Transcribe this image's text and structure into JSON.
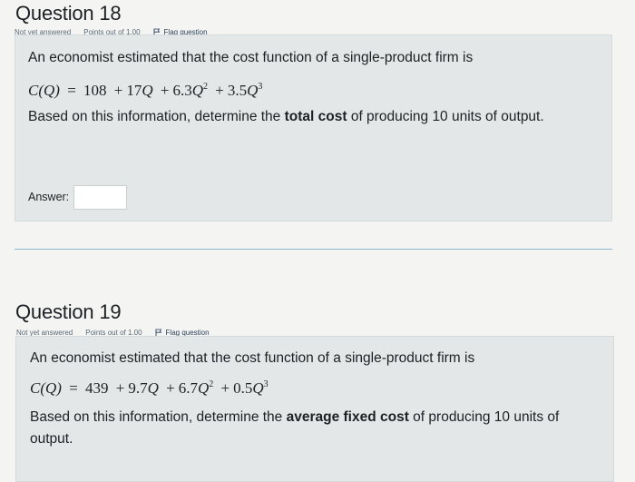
{
  "q18": {
    "title": "Question 18",
    "status": "Not yet answered",
    "points": "Points out of 1.00",
    "flag": "Flag question",
    "text1": "An economist estimated that the cost function of a single-product firm is",
    "formula": {
      "lhs": "C(Q)",
      "eq": "=",
      "c0": "108",
      "plus1": "+",
      "c1": "17",
      "v1": "Q",
      "plus2": "+",
      "c2": "6.3",
      "v2": "Q",
      "e2": "2",
      "plus3": "+",
      "c3": "3.5",
      "v3": "Q",
      "e3": "3"
    },
    "text2_pre": "Based on this information, determine the ",
    "text2_bold": "total cost",
    "text2_post": " of producing 10 units of output.",
    "answer_label": "Answer:",
    "answer_value": ""
  },
  "q19": {
    "title": "Question 19",
    "status": "Not yet answered",
    "points": "Points out of 1.00",
    "flag": "Flag question",
    "text1": "An economist estimated that the cost function of a single-product firm is",
    "formula": {
      "lhs": "C(Q)",
      "eq": "=",
      "c0": "439",
      "plus1": "+",
      "c1": "9.7",
      "v1": "Q",
      "plus2": "+",
      "c2": "6.7",
      "v2": "Q",
      "e2": "2",
      "plus3": "+",
      "c3": "0.5",
      "v3": "Q",
      "e3": "3"
    },
    "text2_pre": "Based on this information, determine the ",
    "text2_bold": "average fixed cost",
    "text2_post": " of producing 10 units of output."
  },
  "colors": {
    "content_bg": "#e3e7e8",
    "page_bg": "#f4f4f2",
    "divider": "#8ab8cc"
  }
}
